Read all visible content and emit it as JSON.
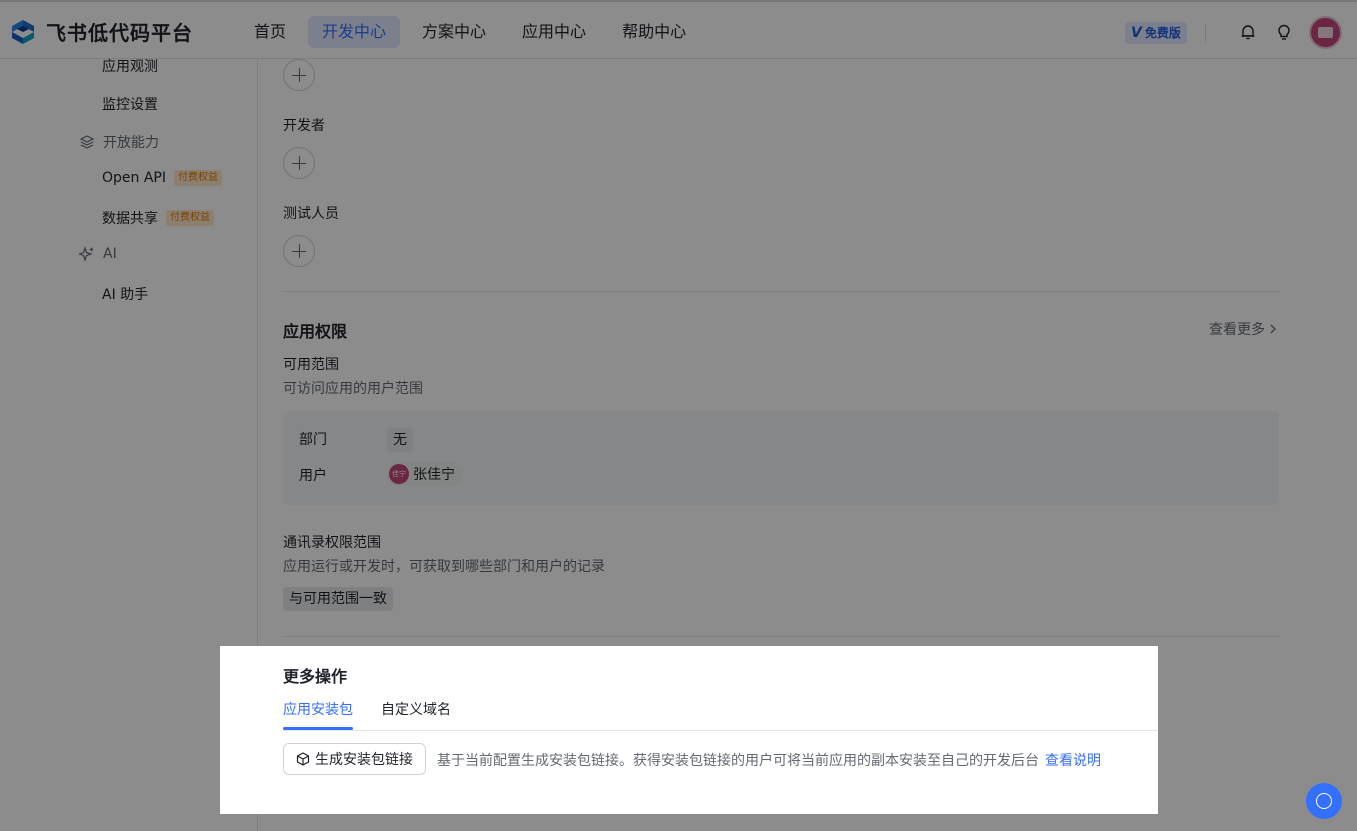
{
  "header": {
    "brand": "飞书低代码平台",
    "nav": [
      "首页",
      "开发中心",
      "方案中心",
      "应用中心",
      "帮助中心"
    ],
    "active_nav": "开发中心",
    "plan_badge_v": "V",
    "plan_badge": "免费版"
  },
  "sidebar": {
    "app_observe": "应用观测",
    "monitor_settings": "监控设置",
    "open_capability": "开放能力",
    "open_api": "Open API",
    "paid_tag": "付费权益",
    "data_share": "数据共享",
    "ai_group": "AI",
    "ai_assistant": "AI 助手"
  },
  "members": {
    "developers": "开发者",
    "testers": "测试人员"
  },
  "permissions": {
    "title": "应用权限",
    "more": "查看更多",
    "scope_title": "可用范围",
    "scope_desc": "可访问应用的用户范围",
    "dept_label": "部门",
    "dept_value": "无",
    "user_label": "用户",
    "user_avatar_text": "佳宁",
    "user_name": "张佳宁",
    "contacts_title": "通讯录权限范围",
    "contacts_desc": "应用运行或开发时，可获取到哪些部门和用户的记录",
    "contacts_value": "与可用范围一致"
  },
  "more_ops": {
    "title": "更多操作",
    "tabs": [
      "应用安装包",
      "自定义域名"
    ],
    "active_tab": "应用安装包",
    "generate_button": "生成安装包链接",
    "description": "基于当前配置生成安装包链接。获得安装包链接的用户可将当前应用的副本安装至自己的开发后台",
    "view_docs": "查看说明"
  },
  "colors": {
    "accent": "#3370ff",
    "paid_tag_text": "#de7802",
    "paid_tag_bg": "#fee7cd"
  }
}
